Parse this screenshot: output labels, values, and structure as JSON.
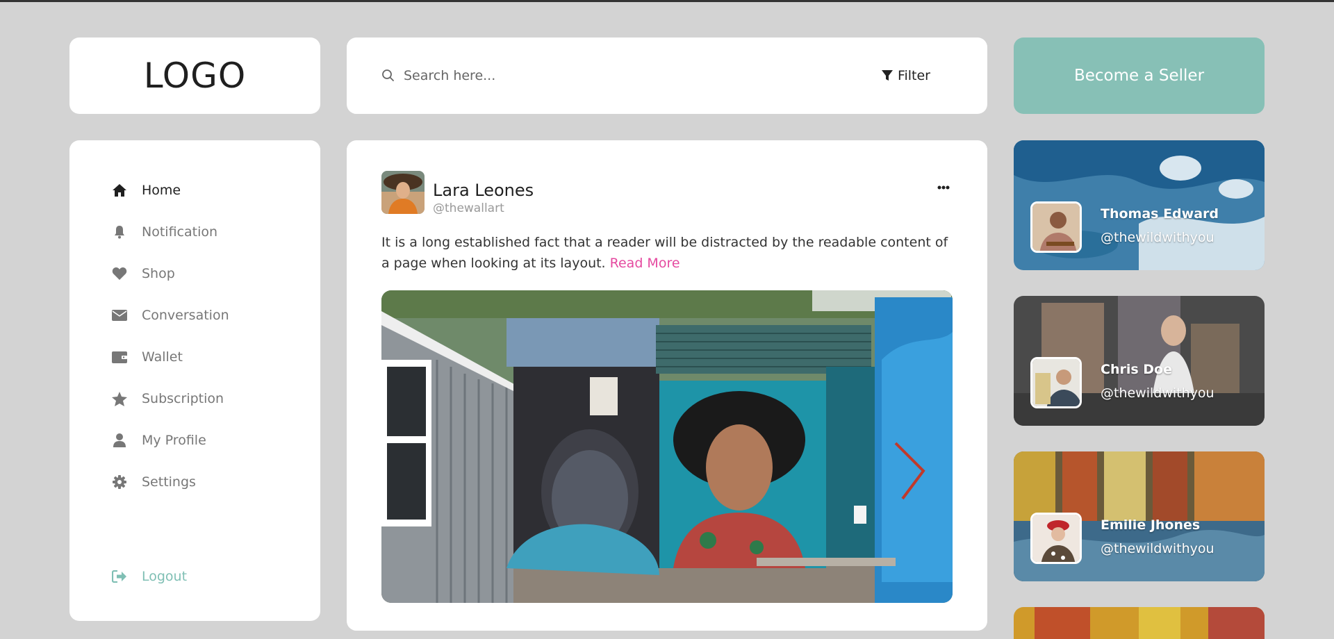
{
  "logo": {
    "text": "LOGO"
  },
  "search": {
    "placeholder": "Search here...",
    "filter_label": "Filter"
  },
  "seller": {
    "label": "Become a Seller"
  },
  "nav": {
    "items": [
      {
        "label": "Home",
        "icon": "home-icon"
      },
      {
        "label": "Notification",
        "icon": "bell-icon"
      },
      {
        "label": "Shop",
        "icon": "heart-icon"
      },
      {
        "label": "Conversation",
        "icon": "envelope-icon"
      },
      {
        "label": "Wallet",
        "icon": "wallet-icon"
      },
      {
        "label": "Subscription",
        "icon": "star-icon"
      },
      {
        "label": "My Profile",
        "icon": "user-icon"
      },
      {
        "label": "Settings",
        "icon": "gear-icon"
      }
    ],
    "logout": {
      "label": "Logout",
      "icon": "sign-out-icon"
    }
  },
  "post": {
    "author": "Lara Leones",
    "handle": "@thewallart",
    "text": "It is a long established fact that a reader will be distracted by the readable content of a page when looking at its layout. ",
    "read_more": "Read More"
  },
  "users": [
    {
      "name": "Thomas Edward",
      "handle": "@thewildwithyou"
    },
    {
      "name": "Chris Doe",
      "handle": "@thewildwithyou"
    },
    {
      "name": "Emilie Jhones",
      "handle": "@thewildwithyou"
    }
  ],
  "colors": {
    "accent": "#87c0b6",
    "link": "#e54aa0",
    "background": "#d3d3d3"
  }
}
